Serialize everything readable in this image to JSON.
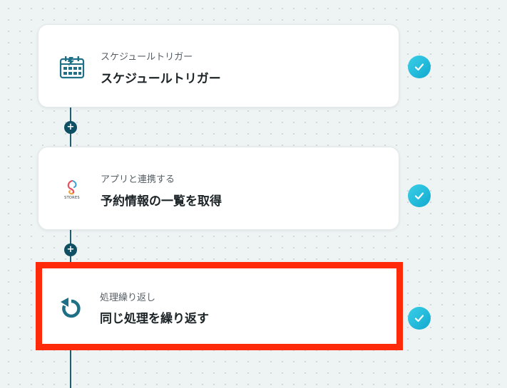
{
  "flow": {
    "steps": [
      {
        "subtitle": "スケジュールトリガー",
        "title": "スケジュールトリガー",
        "icon": "calendar-lightning-icon",
        "status": "completed"
      },
      {
        "subtitle": "アプリと連携する",
        "title": "予約情報の一覧を取得",
        "icon": "stores-logo",
        "logo_text": "STORES",
        "status": "completed"
      },
      {
        "subtitle": "処理繰り返し",
        "title": "同じ処理を繰り返す",
        "icon": "loop-arrow-icon",
        "status": "completed",
        "selected": true
      }
    ],
    "add_step_label": "+"
  },
  "colors": {
    "connector": "#1f5c6e",
    "add_button": "#0f4f63",
    "check": "#22bcdc",
    "selection_highlight": "#ff2a0a",
    "icon_teal": "#1f6f86"
  }
}
